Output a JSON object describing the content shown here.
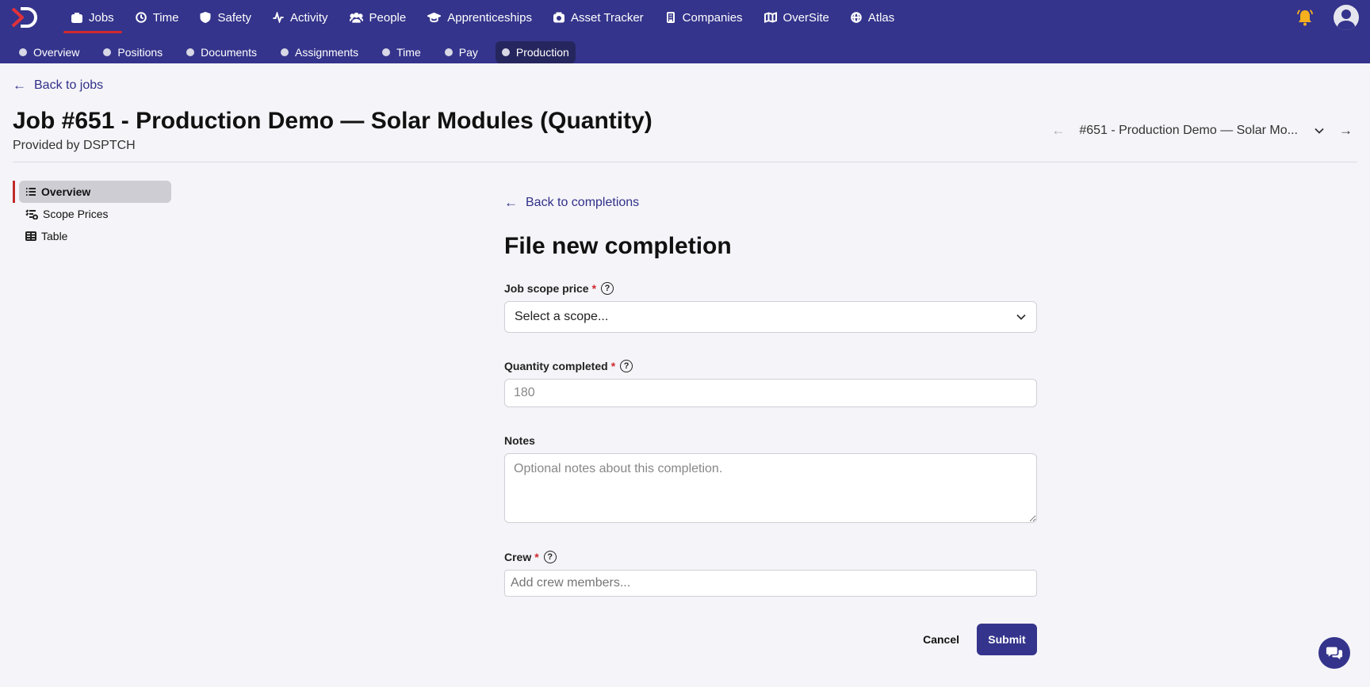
{
  "nav": {
    "items": [
      {
        "label": "Jobs",
        "icon": "briefcase-icon",
        "active": true
      },
      {
        "label": "Time",
        "icon": "clock-icon"
      },
      {
        "label": "Safety",
        "icon": "shield-icon"
      },
      {
        "label": "Activity",
        "icon": "pulse-icon"
      },
      {
        "label": "People",
        "icon": "people-icon"
      },
      {
        "label": "Apprenticeships",
        "icon": "graduation-cap-icon"
      },
      {
        "label": "Asset Tracker",
        "icon": "camera-icon"
      },
      {
        "label": "Companies",
        "icon": "building-icon"
      },
      {
        "label": "OverSite",
        "icon": "map-icon"
      },
      {
        "label": "Atlas",
        "icon": "globe-icon"
      }
    ]
  },
  "subnav": {
    "items": [
      "Overview",
      "Positions",
      "Documents",
      "Assignments",
      "Time",
      "Pay",
      "Production"
    ],
    "active": "Production"
  },
  "header": {
    "back_label": "Back to jobs",
    "title": "Job #651 - Production Demo — Solar Modules (Quantity)",
    "provider": "Provided by DSPTCH",
    "switcher_label": "#651 - Production Demo — Solar Mo..."
  },
  "sidebar": {
    "items": [
      {
        "label": "Overview",
        "icon": "list-icon",
        "active": true
      },
      {
        "label": "Scope Prices",
        "icon": "list-check-icon"
      },
      {
        "label": "Table",
        "icon": "table-icon"
      }
    ]
  },
  "form": {
    "back_label": "Back to completions",
    "title": "File new completion",
    "scope": {
      "label": "Job scope price",
      "required": "*",
      "value": "Select a scope..."
    },
    "quantity": {
      "label": "Quantity completed",
      "required": "*",
      "placeholder": "180"
    },
    "notes": {
      "label": "Notes",
      "placeholder": "Optional notes about this completion."
    },
    "crew": {
      "label": "Crew",
      "required": "*",
      "placeholder": "Add crew members..."
    },
    "cancel_label": "Cancel",
    "submit_label": "Submit"
  },
  "help_glyph": "?",
  "colors": {
    "brand": "#34348c",
    "accent_red": "#d0292e",
    "bell": "#f6b01e"
  }
}
